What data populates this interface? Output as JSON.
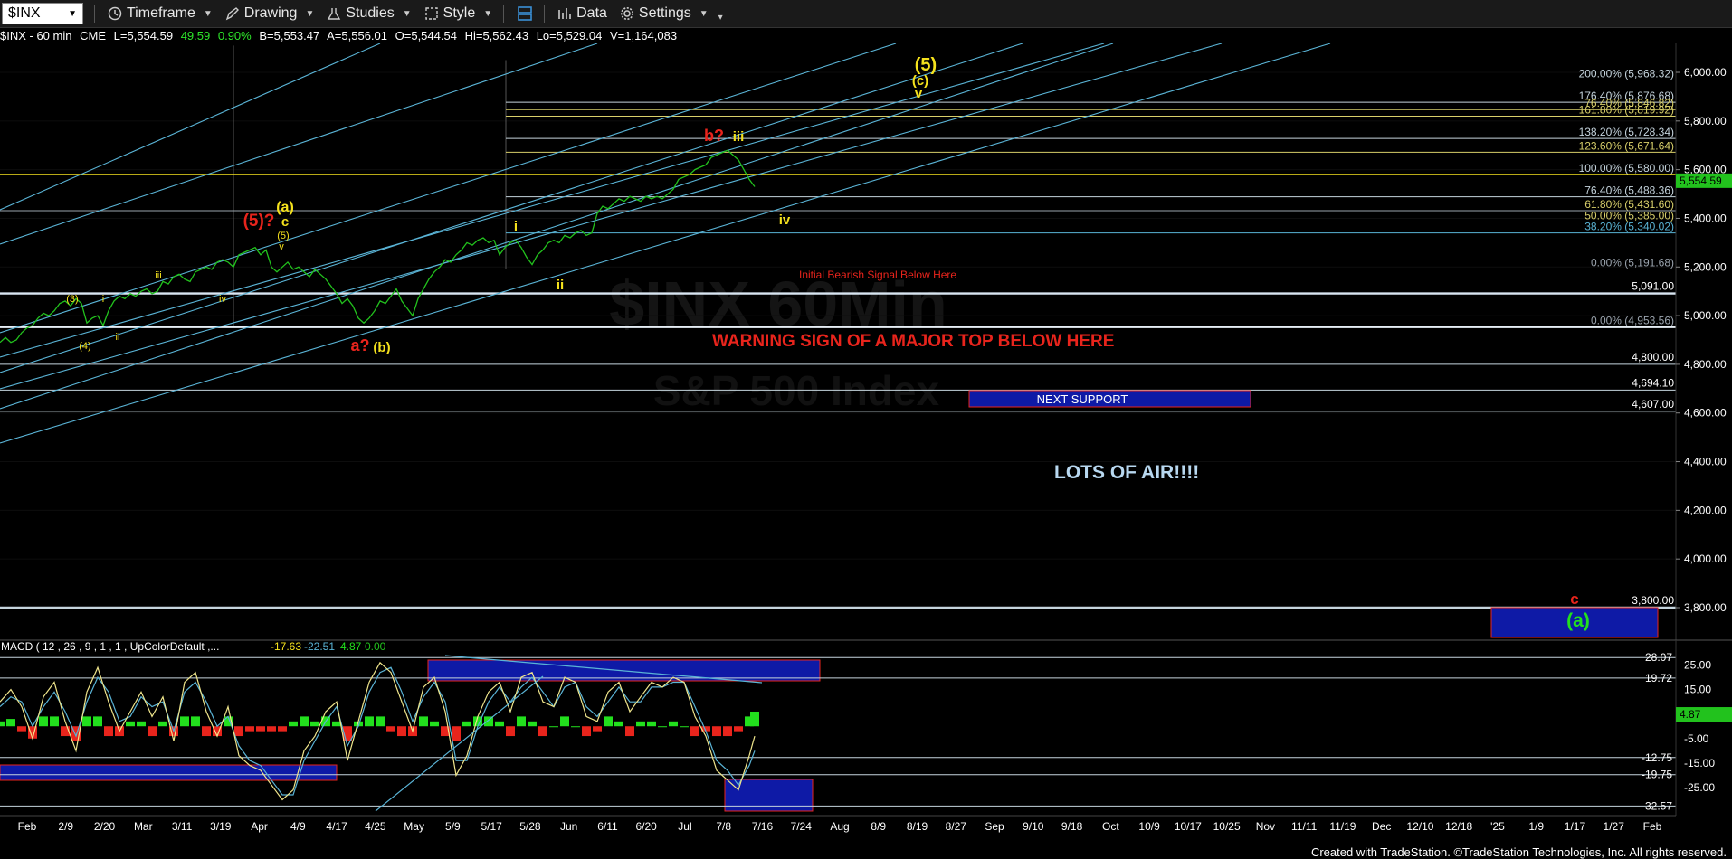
{
  "toolbar": {
    "symbol": "$INX",
    "timeframe": "Timeframe",
    "drawing": "Drawing",
    "studies": "Studies",
    "style": "Style",
    "data": "Data",
    "settings": "Settings"
  },
  "infobar": {
    "label": "$INX - 60 min",
    "exchange": "CME",
    "last": "L=5,554.59",
    "change": "49.59",
    "change_pct": "0.90%",
    "bid": "B=5,553.47",
    "ask": "A=5,556.01",
    "open": "O=5,544.54",
    "high": "Hi=5,562.43",
    "low": "Lo=5,529.04",
    "volume": "V=1,164,083"
  },
  "macd_header": {
    "label": "MACD ( 12 , 26 , 9 , 1 , 1 , UpColorDefault ,...",
    "v1": "-17.63",
    "v2": "-22.51",
    "v3": "4.87",
    "v4": "0.00"
  },
  "footer": "Created with TradeStation. ©TradeStation Technologies, Inc. All rights reserved.",
  "watermark": {
    "line1": "$INX 60Min",
    "line2": "S&P 500 Index"
  },
  "colors": {
    "price": "#22c21d",
    "channel": "#5ab4d6",
    "fib_line": "#9aa3ad",
    "yellow": "#f5e21d",
    "red": "#e8241c",
    "navy": "#0e1aa6",
    "macd_pos": "#22e01d",
    "macd_neg": "#e8241c"
  },
  "chart_data": [
    {
      "type": "line",
      "title": "",
      "price_axis": {
        "ticks": [
          {
            "v": 6000,
            "label": "6,000.00"
          },
          {
            "v": 5800,
            "label": "5,800.00"
          },
          {
            "v": 5600,
            "label": "5,600.00"
          },
          {
            "v": 5400,
            "label": "5,400.00"
          },
          {
            "v": 5200,
            "label": "5,200.00"
          },
          {
            "v": 5000,
            "label": "5,000.00"
          },
          {
            "v": 4800,
            "label": "4,800.00"
          },
          {
            "v": 4600,
            "label": "4,600.00"
          },
          {
            "v": 4400,
            "label": "4,400.00"
          },
          {
            "v": 4200,
            "label": "4,200.00"
          },
          {
            "v": 4000,
            "label": "4,000.00"
          },
          {
            "v": 3800,
            "label": "3,800.00"
          }
        ],
        "ylim": [
          3680,
          6110
        ],
        "last_price": {
          "v": 5554.59,
          "label": "5,554.59"
        }
      },
      "time_axis": {
        "labels": [
          "Feb",
          "2/9",
          "2/20",
          "Mar",
          "3/11",
          "3/19",
          "Apr",
          "4/9",
          "4/17",
          "4/25",
          "May",
          "5/9",
          "5/17",
          "5/28",
          "Jun",
          "6/11",
          "6/20",
          "Jul",
          "7/8",
          "7/16",
          "7/24",
          "Aug",
          "8/9",
          "8/19",
          "8/27",
          "Sep",
          "9/10",
          "9/18",
          "Oct",
          "10/9",
          "10/17",
          "10/25",
          "Nov",
          "11/11",
          "11/19",
          "Dec",
          "12/10",
          "12/18",
          "'25",
          "1/9",
          "1/17",
          "1/27",
          "Feb"
        ]
      },
      "series": [
        {
          "x": [
            0,
            5,
            10,
            15,
            20,
            25,
            30,
            35,
            40,
            45,
            50,
            55,
            60,
            65,
            70,
            75,
            80,
            85,
            90,
            95,
            100,
            105,
            110,
            115,
            120,
            125,
            130,
            135,
            140,
            145,
            150,
            155,
            160,
            165,
            170,
            175,
            180,
            185,
            190,
            195,
            200,
            205,
            210,
            215,
            220,
            225,
            230,
            235,
            240,
            245,
            250,
            255,
            260,
            265,
            270,
            275,
            280,
            285,
            290,
            295,
            300,
            305,
            310,
            315,
            320,
            325,
            330,
            335,
            340,
            345,
            350,
            355,
            360,
            365,
            370,
            375,
            380,
            385,
            390,
            395,
            400,
            405,
            410,
            415,
            420,
            425,
            430,
            435,
            440,
            445,
            450,
            455,
            460,
            465,
            470,
            475,
            480,
            485,
            490,
            495,
            500,
            505,
            510,
            515,
            520,
            525,
            530,
            535,
            540,
            545,
            550,
            555,
            560,
            565,
            570,
            575,
            580,
            585,
            590,
            595,
            600,
            605,
            610,
            615,
            620,
            625,
            630,
            635,
            640,
            645,
            650,
            655,
            660,
            665,
            670,
            675,
            680,
            685,
            690,
            695
          ],
          "y": [
            4890,
            4910,
            4890,
            4900,
            4930,
            4950,
            4960,
            4990,
            5010,
            5000,
            5020,
            5050,
            5060,
            5040,
            5070,
            5050,
            4970,
            4990,
            5000,
            4960,
            5020,
            5060,
            5080,
            5070,
            5090,
            5080,
            5100,
            5110,
            5090,
            5100,
            5140,
            5130,
            5160,
            5170,
            5150,
            5140,
            5180,
            5190,
            5200,
            5190,
            5220,
            5230,
            5220,
            5200,
            5250,
            5260,
            5270,
            5280,
            5250,
            5270,
            5200,
            5180,
            5200,
            5220,
            5190,
            5200,
            5180,
            5160,
            5190,
            5170,
            5150,
            5120,
            5090,
            5050,
            5070,
            5040,
            4990,
            4970,
            4990,
            5020,
            5060,
            5050,
            5080,
            5110,
            5060,
            5030,
            5000,
            5070,
            5110,
            5150,
            5180,
            5200,
            5230,
            5220,
            5250,
            5270,
            5300,
            5290,
            5310,
            5320,
            5300,
            5310,
            5250,
            5280,
            5300,
            5310,
            5280,
            5240,
            5210,
            5250,
            5270,
            5300,
            5310,
            5300,
            5330,
            5320,
            5340,
            5350,
            5330,
            5340,
            5420,
            5450,
            5440,
            5460,
            5480,
            5470,
            5490,
            5480,
            5470,
            5490,
            5480,
            5490,
            5480,
            5500,
            5520,
            5560,
            5570,
            5580,
            5600,
            5610,
            5620,
            5650,
            5660,
            5670,
            5680,
            5660,
            5640,
            5600,
            5560,
            5530
          ]
        }
      ],
      "fib_levels": [
        {
          "v": 5968.32,
          "label": "200.00% (5,968.32)"
        },
        {
          "v": 5876.68,
          "label": "176.40% (5,876.68)"
        },
        {
          "v": 5846.82,
          "label": "76.40% (5,846.82)"
        },
        {
          "v": 5819.92,
          "label": "161.80% (5,819.92)"
        },
        {
          "v": 5728.34,
          "label": "138.20% (5,728.34)"
        },
        {
          "v": 5671.64,
          "label": "123.60% (5,671.64)"
        },
        {
          "v": 5580.0,
          "label": "100.00% (5,580.00)"
        },
        {
          "v": 5488.36,
          "label": "76.40% (5,488.36)"
        },
        {
          "v": 5431.6,
          "label": "61.80% (5,431.60)"
        },
        {
          "v": 5385.0,
          "label": "50.00% (5,385.00)"
        },
        {
          "v": 5340.02,
          "label": "38.20% (5,340.02)"
        },
        {
          "v": 5191.68,
          "label": "0.00% (5,191.68)"
        },
        {
          "v": 4953.56,
          "label": "0.00% (4,953.56)"
        }
      ],
      "support_levels": [
        {
          "v": 5091.0,
          "label": "5,091.00"
        },
        {
          "v": 4800.0,
          "label": "4,800.00"
        },
        {
          "v": 4694.1,
          "label": "4,694.10"
        },
        {
          "v": 4607.0,
          "label": "4,607.00"
        },
        {
          "v": 3800.0,
          "label": "3,800.00"
        }
      ],
      "annotations": [
        {
          "text": "(5)",
          "color": "yellow"
        },
        {
          "text": "(c)",
          "color": "yellow"
        },
        {
          "text": "v",
          "color": "yellow"
        },
        {
          "text": "b?",
          "color": "red"
        },
        {
          "text": "iii",
          "color": "yellow"
        },
        {
          "text": "iv",
          "color": "yellow"
        },
        {
          "text": "i",
          "color": "yellow"
        },
        {
          "text": "ii",
          "color": "yellow"
        },
        {
          "text": "(5)?",
          "color": "red"
        },
        {
          "text": "(a)",
          "color": "yellow"
        },
        {
          "text": "c",
          "color": "yellow"
        },
        {
          "text": "(5)",
          "color": "yellow"
        },
        {
          "text": "v",
          "color": "yellow"
        },
        {
          "text": "iii",
          "color": "yellow"
        },
        {
          "text": "iv",
          "color": "yellow"
        },
        {
          "text": "(3)",
          "color": "yellow"
        },
        {
          "text": "i",
          "color": "yellow"
        },
        {
          "text": "(4)",
          "color": "yellow"
        },
        {
          "text": "ii",
          "color": "yellow"
        },
        {
          "text": "a?",
          "color": "red"
        },
        {
          "text": "(b)",
          "color": "yellow"
        },
        {
          "text": "Initial Bearish Signal Below Here",
          "color": "red"
        },
        {
          "text": "WARNING SIGN OF A MAJOR TOP BELOW HERE",
          "color": "red"
        },
        {
          "text": "NEXT SUPPORT",
          "color": "white"
        },
        {
          "text": "LOTS OF AIR!!!!",
          "color": "lightblue"
        },
        {
          "text": "c",
          "color": "red"
        },
        {
          "text": "(a)",
          "color": "green"
        }
      ]
    },
    {
      "type": "line",
      "title": "",
      "name": "MACD",
      "value_axis": {
        "ticks": [
          {
            "v": 25,
            "label": "25.00"
          },
          {
            "v": 15,
            "label": "15.00"
          },
          {
            "v": 5,
            "label": "5.00"
          },
          {
            "v": -5,
            "label": "-5.00"
          },
          {
            "v": -15,
            "label": "-15.00"
          },
          {
            "v": -25,
            "label": "-25.00"
          }
        ],
        "ylim": [
          -35,
          30
        ],
        "markers": [
          {
            "v": 28.07,
            "label": "28.07"
          },
          {
            "v": 19.72,
            "label": "19.72"
          },
          {
            "v": -12.75,
            "label": "-12.75"
          },
          {
            "v": -19.75,
            "label": "-19.75"
          },
          {
            "v": -32.57,
            "label": "-32.57"
          }
        ],
        "last_value": {
          "v": 4.87,
          "label": "4.87"
        }
      },
      "x": [
        0,
        10,
        20,
        30,
        40,
        50,
        60,
        70,
        80,
        90,
        100,
        110,
        120,
        130,
        140,
        150,
        160,
        170,
        180,
        190,
        200,
        210,
        220,
        230,
        240,
        250,
        260,
        270,
        280,
        290,
        300,
        310,
        320,
        330,
        340,
        350,
        360,
        370,
        380,
        390,
        400,
        410,
        420,
        430,
        440,
        450,
        460,
        470,
        480,
        490,
        500,
        510,
        520,
        530,
        540,
        550,
        560,
        570,
        580,
        590,
        600,
        610,
        620,
        630,
        640,
        650,
        660,
        670,
        680,
        690,
        695
      ],
      "macd": [
        10,
        15,
        8,
        -5,
        12,
        18,
        2,
        -10,
        14,
        24,
        10,
        -2,
        6,
        14,
        4,
        12,
        -6,
        18,
        22,
        6,
        -4,
        8,
        -12,
        -16,
        -18,
        -24,
        -30,
        -26,
        -10,
        -4,
        6,
        10,
        -14,
        2,
        18,
        26,
        22,
        10,
        -2,
        16,
        20,
        6,
        -20,
        -12,
        4,
        14,
        18,
        6,
        20,
        22,
        10,
        8,
        20,
        18,
        4,
        2,
        14,
        18,
        6,
        12,
        18,
        16,
        20,
        18,
        4,
        -4,
        -18,
        -22,
        -26,
        -12,
        -4
      ],
      "signal": [
        8,
        12,
        10,
        0,
        8,
        14,
        6,
        -4,
        10,
        20,
        14,
        2,
        4,
        12,
        8,
        10,
        -2,
        14,
        18,
        10,
        0,
        4,
        -8,
        -14,
        -16,
        -22,
        -28,
        -28,
        -14,
        -6,
        2,
        8,
        -8,
        0,
        14,
        22,
        24,
        14,
        2,
        12,
        18,
        10,
        -14,
        -14,
        0,
        10,
        16,
        10,
        16,
        20,
        14,
        8,
        16,
        18,
        8,
        4,
        10,
        16,
        10,
        10,
        16,
        16,
        18,
        18,
        8,
        -2,
        -14,
        -18,
        -24,
        -16,
        -10
      ],
      "histogram": [
        2,
        3,
        -2,
        -5,
        4,
        4,
        -4,
        -6,
        4,
        4,
        -4,
        -4,
        2,
        2,
        -4,
        2,
        -4,
        4,
        4,
        -4,
        -4,
        4,
        -4,
        -2,
        -2,
        -2,
        -2,
        2,
        4,
        2,
        4,
        2,
        -6,
        2,
        4,
        4,
        -2,
        -4,
        -4,
        4,
        2,
        -4,
        -6,
        2,
        4,
        4,
        2,
        -4,
        4,
        2,
        -4,
        0,
        4,
        0,
        -4,
        -2,
        4,
        2,
        -4,
        2,
        2,
        0,
        2,
        0,
        -4,
        -2,
        -4,
        -4,
        -2,
        4,
        6
      ]
    }
  ]
}
